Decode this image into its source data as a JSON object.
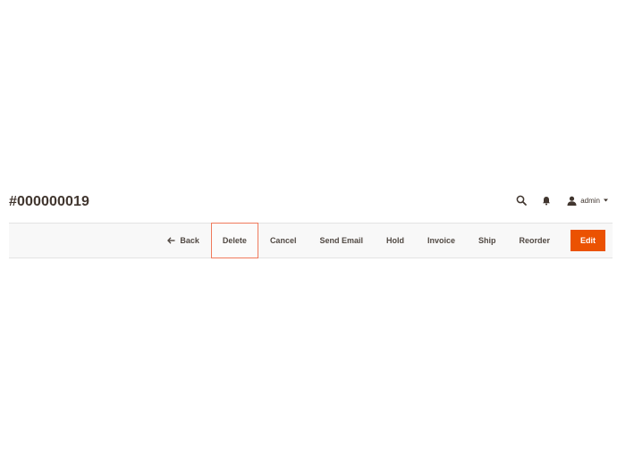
{
  "page": {
    "title": "#000000019"
  },
  "header": {
    "search_icon": "search-icon",
    "notifications_icon": "bell-icon",
    "user": {
      "icon": "user-icon",
      "name": "admin"
    }
  },
  "toolbar": {
    "back_label": "Back",
    "delete_label": "Delete",
    "cancel_label": "Cancel",
    "send_email_label": "Send Email",
    "hold_label": "Hold",
    "invoice_label": "Invoice",
    "ship_label": "Ship",
    "reorder_label": "Reorder",
    "edit_label": "Edit"
  },
  "colors": {
    "primary_button": "#eb5202",
    "focus_outline": "#f07a5c",
    "toolbar_bg": "#f8f8f8",
    "text": "#514943"
  }
}
